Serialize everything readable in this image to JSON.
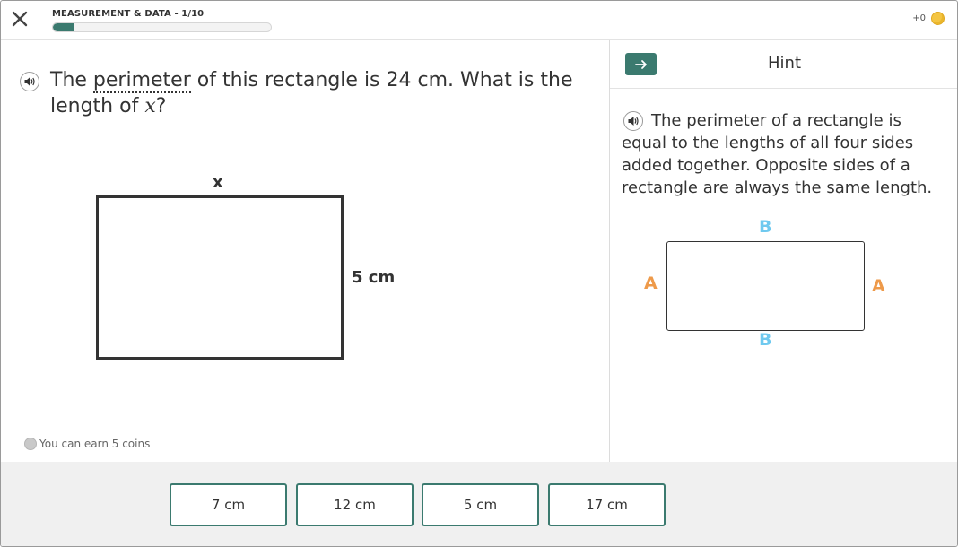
{
  "header": {
    "close_icon": "close-icon",
    "section_title": "MEASUREMENT & DATA - 1/10",
    "progress": 0.1,
    "coins_text": "+0",
    "coin_icon": "coin-icon"
  },
  "question": {
    "speaker_icon": "speaker-icon",
    "text_before": "The ",
    "vocab_word": "perimeter",
    "text_after": " of this rectangle is 24 cm. What is the length of ",
    "variable": "x",
    "text_end": "?",
    "figure": {
      "top_label": "x",
      "side_label": "5 cm"
    },
    "earn_text": "You can earn 5 coins"
  },
  "hint": {
    "arrow_icon": "arrow-right-icon",
    "title": "Hint",
    "text": "The perimeter of a rectangle is equal to the lengths of all four sides added together. Opposite sides of a rectangle are always the same length.",
    "figure": {
      "top": "B",
      "bottom": "B",
      "left": "A",
      "right": "A"
    },
    "colors": {
      "b": "#6fc9ef",
      "a": "#ee9a4a"
    }
  },
  "answers": [
    {
      "label": "7 cm"
    },
    {
      "label": "12 cm"
    },
    {
      "label": "5 cm"
    },
    {
      "label": "17 cm"
    }
  ],
  "colors": {
    "accent": "#3b7a6f",
    "coin": "#f4c542"
  }
}
